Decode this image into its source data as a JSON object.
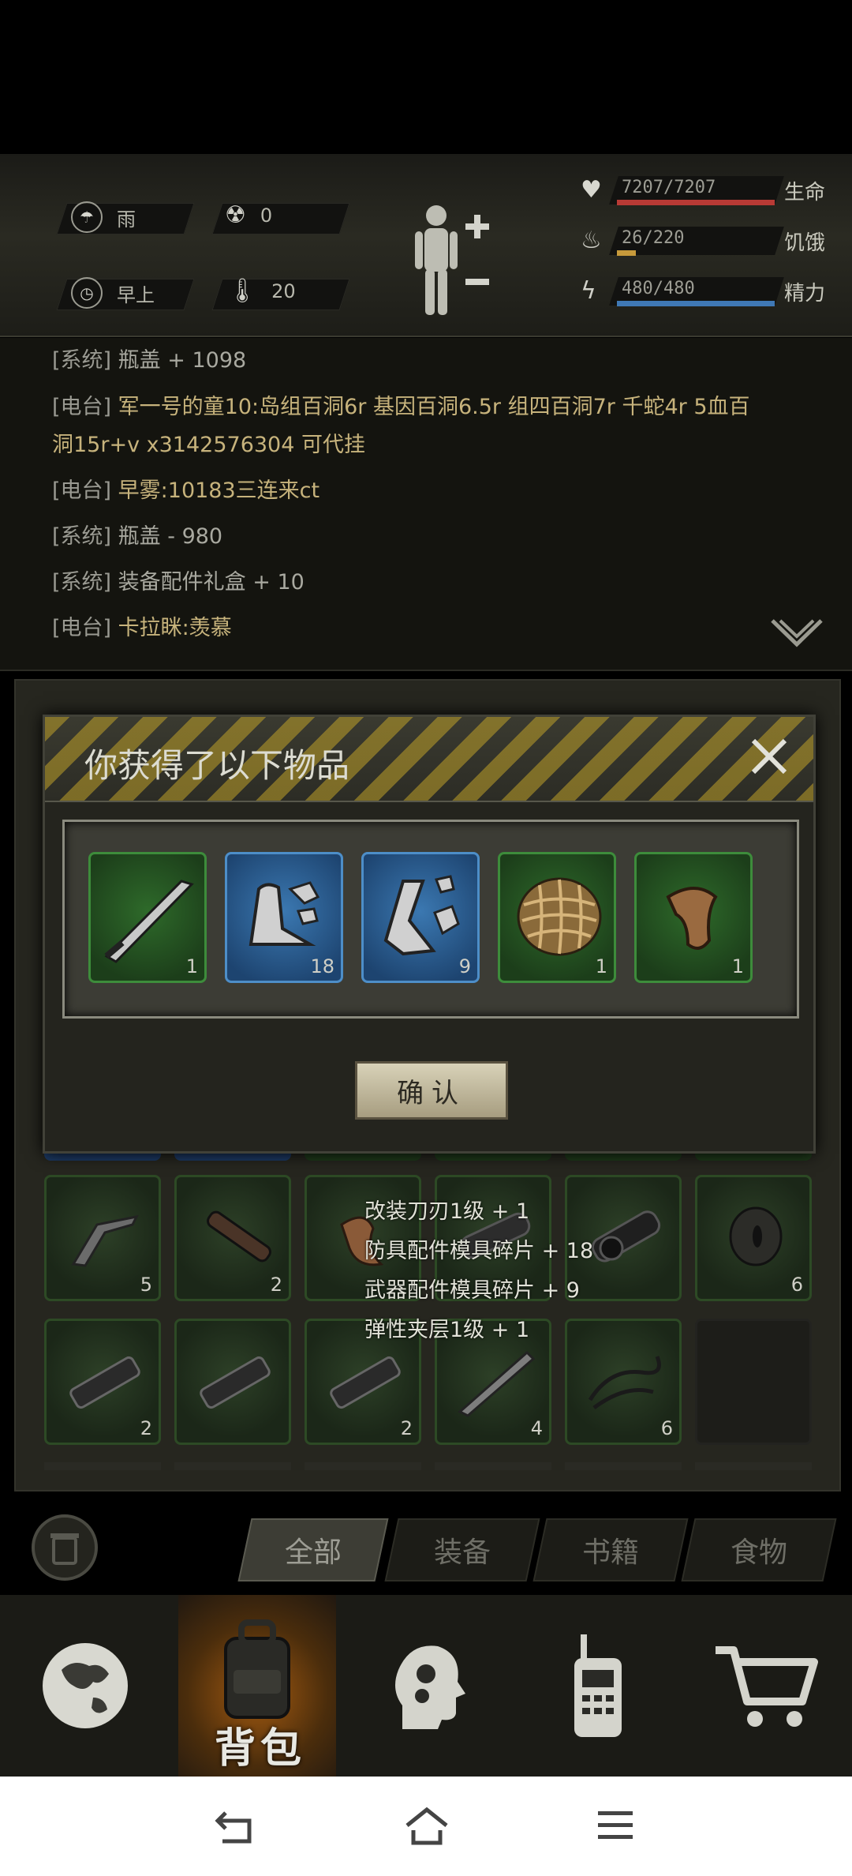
{
  "hud": {
    "weather": {
      "icon": "rain-cloud-icon",
      "label": "雨"
    },
    "radiation": {
      "icon": "radiation-icon",
      "value": "0"
    },
    "time": {
      "icon": "clock-icon",
      "label": "早上"
    },
    "temperature": {
      "icon": "thermometer-icon",
      "value": "20"
    },
    "stats": [
      {
        "icon": "heart-icon",
        "value": "7207/7207",
        "label": "生命",
        "fill": 1.0,
        "color": "#b83a35"
      },
      {
        "icon": "stomach-icon",
        "value": "26/220",
        "label": "饥饿",
        "fill": 0.118,
        "color": "#c79a3b"
      },
      {
        "icon": "lightning-icon",
        "value": "480/480",
        "label": "精力",
        "fill": 1.0,
        "color": "#3f78b5"
      }
    ]
  },
  "log": [
    {
      "tag": "[系统]",
      "text": "瓶盖 + 1098",
      "speaker": ""
    },
    {
      "tag": "[电台]",
      "speaker": "军一号的童10",
      "text": ":岛组百洞6r 基因百洞6.5r 组四百洞7r 千蛇4r 5血百"
    },
    {
      "tag": "",
      "speaker": "",
      "text": "洞15r+v x3142576304 可代挂"
    },
    {
      "tag": "[电台]",
      "speaker": "早雾",
      "text": ":10183三连来ct"
    },
    {
      "tag": "[系统]",
      "speaker": "",
      "text": "瓶盖 - 980"
    },
    {
      "tag": "[系统]",
      "speaker": "",
      "text": "装备配件礼盒 + 10"
    },
    {
      "tag": "[电台]",
      "speaker": "卡拉眯",
      "text": ":羡慕"
    }
  ],
  "inventory": {
    "row1": [
      {
        "icon": "foregrip-icon",
        "count": "5"
      },
      {
        "icon": "handle-icon",
        "count": "2"
      },
      {
        "icon": "grip-icon",
        "count": ""
      },
      {
        "icon": "scope-icon",
        "count": ""
      },
      {
        "icon": "scope-icon",
        "count": ""
      },
      {
        "icon": "washer-icon",
        "count": "6"
      }
    ],
    "row2": [
      {
        "icon": "muzzle-brake-icon",
        "count": "2"
      },
      {
        "icon": "muzzle-brake-icon",
        "count": ""
      },
      {
        "icon": "muzzle-brake-icon",
        "count": "2"
      },
      {
        "icon": "blade-icon",
        "count": "4"
      },
      {
        "icon": "rope-icon",
        "count": "6"
      },
      {
        "icon": "",
        "count": ""
      }
    ]
  },
  "tooltip": [
    "改装刀刃1级 + 1",
    "防具配件模具碎片 + 18",
    "武器配件模具碎片 + 9",
    "弹性夹层1级 + 1"
  ],
  "tabs": [
    "全部",
    "装备",
    "书籍",
    "食物"
  ],
  "nav": {
    "items": [
      "globe-icon",
      "backpack-icon",
      "brain-gear-icon",
      "walkie-talkie-icon",
      "cart-icon"
    ],
    "active_label": "背包"
  },
  "modal": {
    "title": "你获得了以下物品",
    "items": [
      {
        "icon": "blade-icon",
        "count": "1",
        "rarity": "green"
      },
      {
        "icon": "armor-mold-fragment-icon",
        "count": "18",
        "rarity": "blue"
      },
      {
        "icon": "weapon-mold-fragment-icon",
        "count": "9",
        "rarity": "blue"
      },
      {
        "icon": "mesh-layer-icon",
        "count": "1",
        "rarity": "green"
      },
      {
        "icon": "grip-icon",
        "count": "1",
        "rarity": "green"
      }
    ],
    "confirm_label": "确认"
  },
  "system_nav": [
    "back-icon",
    "home-icon",
    "menu-icon"
  ]
}
